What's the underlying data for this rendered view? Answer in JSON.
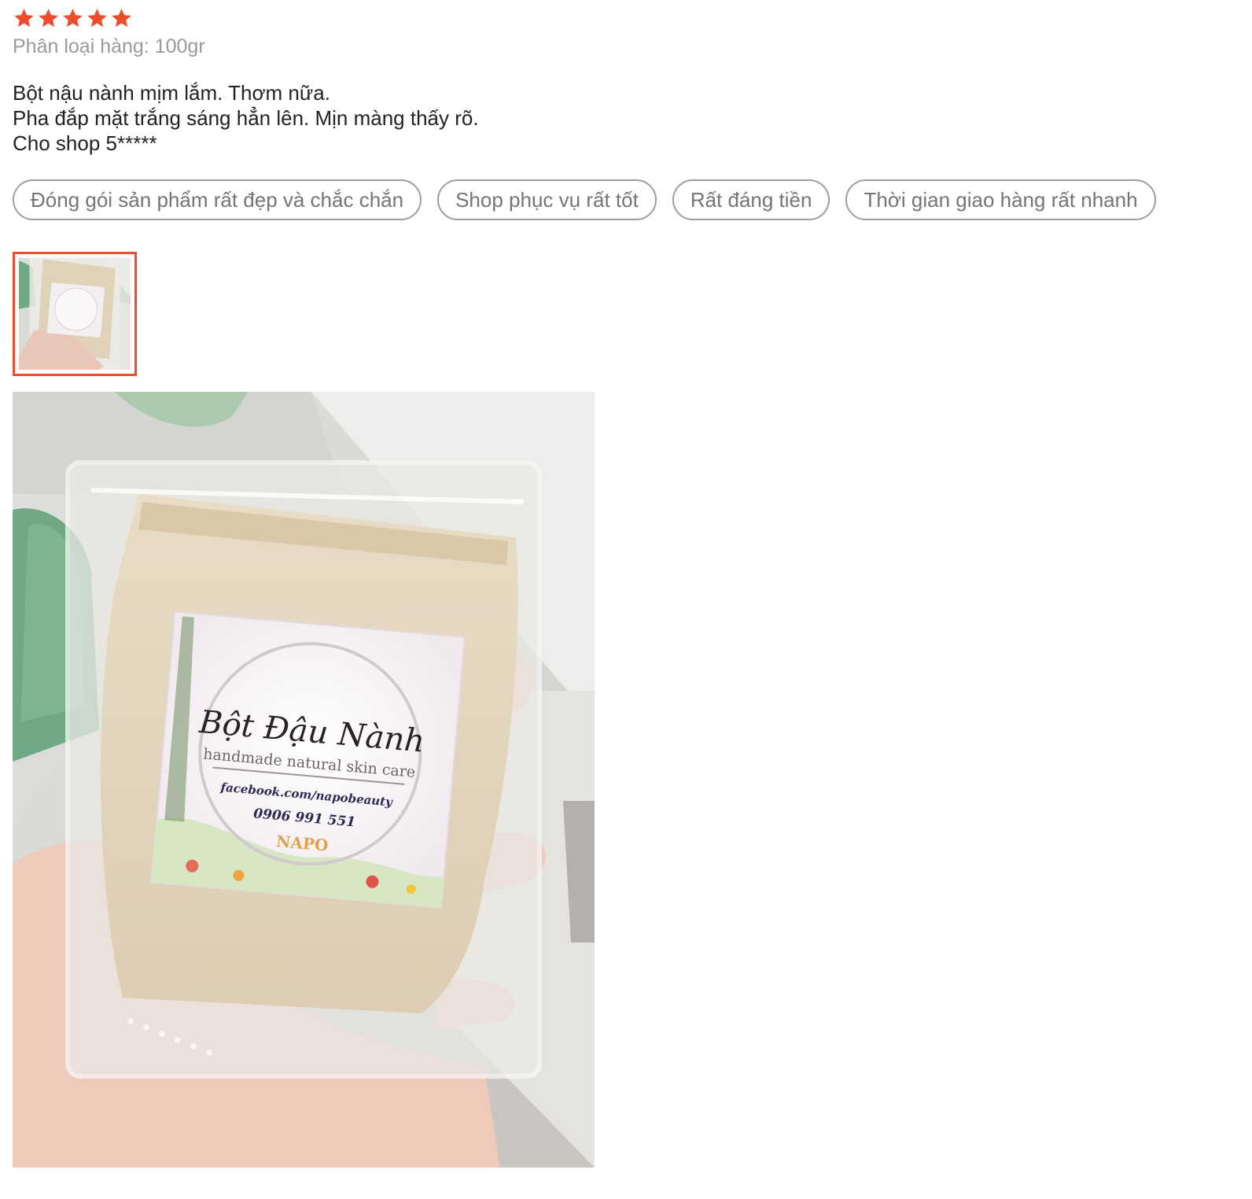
{
  "rating": {
    "stars": 5,
    "max": 5,
    "color": "#ee4d2d"
  },
  "variation": {
    "text": "Phân loại hàng: 100gr"
  },
  "comment": {
    "lines": [
      "Bột nậu nành mịm lắm. Thơm nữa.",
      "Pha đắp mặt trắng sáng hẳn lên. Mịn màng thấy rõ.",
      "Cho shop 5*****"
    ]
  },
  "tags": [
    "Đóng gói sản phẩm rất đẹp và chắc chắn",
    "Shop phục vụ rất tốt",
    "Rất đáng tiền",
    "Thời gian giao hàng rất nhanh"
  ],
  "photo": {
    "label_title": "Bột Đậu Nành",
    "label_subtitle": "handmade natural skin care",
    "label_facebook": "facebook.com/napobeauty",
    "label_phone": "0906 991 551",
    "label_brand": "NAPO"
  },
  "colors": {
    "accent": "#ee4d2d",
    "tag_border": "#9e9e9e",
    "tag_text": "#757575",
    "muted_text": "#9a9a9a",
    "body_text": "#222222"
  }
}
